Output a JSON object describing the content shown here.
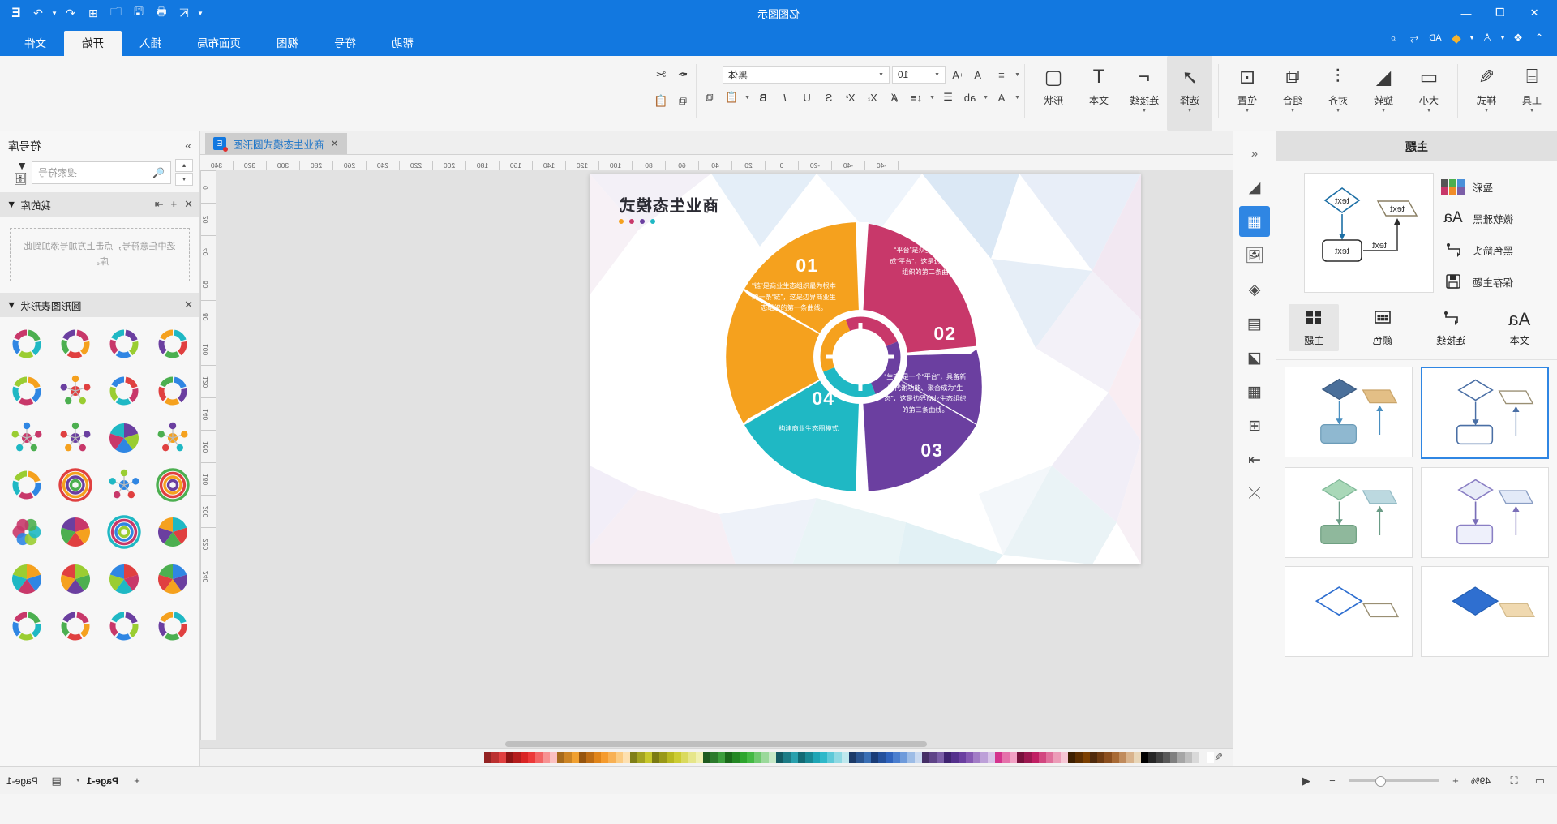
{
  "app": {
    "title": "亿图图示",
    "logo": "E"
  },
  "titlebar": {
    "window_controls": [
      "minimize",
      "maximize",
      "close"
    ],
    "quick_access": [
      {
        "name": "redo-icon",
        "glyph": "↷"
      },
      {
        "name": "undo-icon",
        "glyph": "↶"
      },
      {
        "name": "new-icon",
        "glyph": "⊞"
      },
      {
        "name": "open-icon",
        "glyph": "🗁"
      },
      {
        "name": "save-icon",
        "glyph": "🖫"
      },
      {
        "name": "print-icon",
        "glyph": "🖶"
      },
      {
        "name": "export-icon",
        "glyph": "⇱"
      },
      {
        "name": "customize-qat-icon",
        "glyph": "▼"
      }
    ]
  },
  "tabs": {
    "items": [
      {
        "label": "文件",
        "active": false
      },
      {
        "label": "开始",
        "active": true
      },
      {
        "label": "插入",
        "active": false
      },
      {
        "label": "页面布局",
        "active": false
      },
      {
        "label": "视图",
        "active": false
      },
      {
        "label": "符号",
        "active": false
      },
      {
        "label": "帮助",
        "active": false
      }
    ],
    "left_tools": [
      {
        "name": "pointer-icon",
        "glyph": "⌁"
      },
      {
        "name": "connector-tool-icon",
        "glyph": "⤳"
      },
      {
        "name": "ad-label",
        "glyph": "AD"
      },
      {
        "name": "diamond-icon",
        "glyph": "◆"
      },
      {
        "name": "shirt-icon",
        "glyph": "♕"
      },
      {
        "name": "grid-apps-icon",
        "glyph": "⊞"
      },
      {
        "name": "collapse-ribbon-icon",
        "glyph": "^"
      }
    ]
  },
  "ribbon": {
    "groups": [
      {
        "name": "shape",
        "label": "形状",
        "icon": "▢"
      },
      {
        "name": "text",
        "label": "文本",
        "icon": "T"
      },
      {
        "name": "connector",
        "label": "连接线",
        "icon": "⌐"
      },
      {
        "name": "select",
        "label": "选择",
        "icon": "↗",
        "selected": true
      },
      {
        "name": "position",
        "label": "位置",
        "icon": "⊡"
      },
      {
        "name": "combine",
        "label": "组合",
        "icon": "⧉"
      },
      {
        "name": "align",
        "label": "对齐",
        "icon": "≡"
      },
      {
        "name": "rotate",
        "label": "旋转",
        "icon": "◣"
      },
      {
        "name": "size",
        "label": "大小",
        "icon": "▭"
      },
      {
        "name": "style",
        "label": "样式",
        "icon": "✎"
      },
      {
        "name": "tools",
        "label": "工具",
        "icon": "⌸"
      }
    ],
    "font": {
      "family": "黑体",
      "size": "10",
      "buttons_row1": [
        {
          "name": "increase-font-size-icon",
          "glyph": "A",
          "sup": "+"
        },
        {
          "name": "decrease-font-size-icon",
          "glyph": "A",
          "sup": "−"
        },
        {
          "name": "align-text-icon",
          "glyph": "≡"
        }
      ],
      "buttons_row2": [
        {
          "name": "copy-format-icon",
          "glyph": "⧉"
        },
        {
          "name": "paste-icon",
          "glyph": "📋"
        },
        {
          "name": "bold-icon",
          "glyph": "B"
        },
        {
          "name": "italic-icon",
          "glyph": "I"
        },
        {
          "name": "underline-icon",
          "glyph": "U"
        },
        {
          "name": "strikethrough-icon",
          "glyph": "S"
        },
        {
          "name": "superscript-icon",
          "glyph": "X"
        },
        {
          "name": "subscript-icon",
          "glyph": "X"
        },
        {
          "name": "text-case-icon",
          "glyph": "Aa"
        },
        {
          "name": "line-spacing-icon",
          "glyph": "≡"
        },
        {
          "name": "bullet-list-icon",
          "glyph": "≔"
        }
      ],
      "right_buttons": [
        {
          "name": "cut-icon",
          "glyph": "✂"
        },
        {
          "name": "format-painter-icon",
          "glyph": "✒"
        }
      ]
    }
  },
  "left_panel": {
    "title": "主题",
    "rows": [
      {
        "label": "保存主题",
        "icon": "save-theme-icon",
        "glyph": "🖫"
      },
      {
        "label": "黑色箭头",
        "icon": "connector-style-icon",
        "glyph": "⌐"
      },
      {
        "label": "微软雅黑",
        "icon": "font-theme-icon",
        "glyph": "Aa"
      },
      {
        "label": "盈彩",
        "icon": "color-theme-icon",
        "glyph": "swatches"
      }
    ],
    "swatches": [
      "#4a90d9",
      "#4caf50",
      "#555555",
      "#7b5ea7",
      "#f08c28",
      "#c8386a"
    ],
    "tabs": [
      {
        "label": "主题",
        "icon": "theme-icon",
        "glyph": "▦",
        "active": true
      },
      {
        "label": "颜色",
        "icon": "palette-icon",
        "glyph": "▩",
        "active": false
      },
      {
        "label": "连接线",
        "icon": "connector-icon",
        "glyph": "⌐",
        "active": false
      },
      {
        "label": "文本",
        "icon": "text-icon",
        "glyph": "Aa",
        "active": false
      }
    ],
    "preview_label": "text"
  },
  "rail": {
    "items": [
      {
        "name": "collapse-panel-icon",
        "glyph": "«"
      },
      {
        "name": "fill-icon",
        "glyph": "◣"
      },
      {
        "name": "theme-grid-icon",
        "glyph": "▦",
        "active": true
      },
      {
        "name": "image-icon",
        "glyph": "🖼"
      },
      {
        "name": "layers-icon",
        "glyph": "◈"
      },
      {
        "name": "notes-icon",
        "glyph": "📄"
      },
      {
        "name": "chart-icon",
        "glyph": "◪"
      },
      {
        "name": "table-icon",
        "glyph": "▦"
      },
      {
        "name": "container-icon",
        "glyph": "⊞"
      },
      {
        "name": "align-tool-icon",
        "glyph": "⇤"
      },
      {
        "name": "shuffle-icon",
        "glyph": "⤬"
      }
    ]
  },
  "document": {
    "tab_title": "商业生态模式圆形图",
    "ruler_h": [
      "340",
      "320",
      "300",
      "280",
      "260",
      "240",
      "220",
      "200",
      "180",
      "160",
      "140",
      "120",
      "100",
      "80",
      "60",
      "40",
      "20",
      "0",
      "-20",
      "-40"
    ],
    "ruler_v": [
      "0",
      "20",
      "40",
      "60",
      "80",
      "100",
      "120",
      "140",
      "160",
      "180",
      "200",
      "220",
      "240"
    ]
  },
  "chart_data": {
    "type": "pie",
    "title": "商业生态模式",
    "legend_dots": [
      "#1fb8c4",
      "#6b3fa0",
      "#c8386a",
      "#f5a11e"
    ],
    "center_hub": true,
    "segments": [
      {
        "number": "01",
        "color": "#f5a11e",
        "text": "“链”是商业生态组织最为根本的一条“链”，这是边界商业生态组织的第一条曲线。"
      },
      {
        "number": "02",
        "color": "#c8386a",
        "text": "“平台”是众多的“链”聚合形成“平台”，这是边界商业生态组织的第二条曲线。"
      },
      {
        "number": "03",
        "color": "#6b3fa0",
        "text": "“生态”是一个“平台”，具备新陈代谢功能、聚合成为“生态”，这是边界商业生态组织的第三条曲线。"
      },
      {
        "number": "04",
        "color": "#1fb8c4",
        "text": "构建商业生态圈模式"
      }
    ]
  },
  "right_panel": {
    "title": "符号库",
    "collapse_icon": "»",
    "search_placeholder": "搜索符号",
    "library_icon": "symbol-library-icon",
    "sections": [
      {
        "title": "我的库",
        "actions": [
          "import-icon",
          "add-icon",
          "close-icon"
        ],
        "empty_text": "选中任意符号，点击上方加号添加到此库。"
      },
      {
        "title": "圆形图表形状",
        "actions": [
          "close-icon"
        ]
      }
    ]
  },
  "status_bar": {
    "zoom_out_icon": "−",
    "zoom_in_icon": "+",
    "zoom_percent": "49%",
    "fullscreen_icon": "⛶",
    "fit_icon": "⤢",
    "play_icon": "◀",
    "page_current": "Page-1",
    "page_name": "Page-1",
    "add_page_icon": "+",
    "page_list_icon": "▭"
  },
  "palette": {
    "colors": [
      "#ffffff",
      "#f2f2f2",
      "#d9d9d9",
      "#bfbfbf",
      "#a6a6a6",
      "#808080",
      "#595959",
      "#404040",
      "#262626",
      "#000000",
      "#e8d5b7",
      "#d9b38c",
      "#c08b5c",
      "#a86a35",
      "#8b4f1f",
      "#6d3b12",
      "#4f2a0c",
      "#7b3f00",
      "#5c2e00",
      "#3d1f00",
      "#f6c6d4",
      "#ec9cb8",
      "#e0709c",
      "#d24780",
      "#c01f63",
      "#9c1850",
      "#77113c",
      "#f2a0c4",
      "#e571ab",
      "#d4338d",
      "#d8c4e8",
      "#bda0d8",
      "#a27cc6",
      "#8659b3",
      "#6b3fa0",
      "#54308c",
      "#3f2370",
      "#7b5ea7",
      "#5f4488",
      "#452f66",
      "#c9d9f0",
      "#9dbce6",
      "#6f9bdb",
      "#4a7ecf",
      "#2f63bd",
      "#24509c",
      "#1a3c77",
      "#3a6fb5",
      "#2a5490",
      "#1c3a68",
      "#bfe8ee",
      "#8fd9e3",
      "#5ec9d8",
      "#2fb8c9",
      "#1fa5b5",
      "#188894",
      "#126a74",
      "#29a0ad",
      "#1d7c86",
      "#135a62",
      "#c6e8c6",
      "#9bd99b",
      "#6fc96f",
      "#44b944",
      "#2ea52e",
      "#248724",
      "#1a691a",
      "#3c9e3c",
      "#2c7a2c",
      "#1e5a1e",
      "#f0f0b0",
      "#e6e68a",
      "#dada5e",
      "#cccc33",
      "#b8b820",
      "#999918",
      "#7a7a12",
      "#c7c72b",
      "#a3a320",
      "#7f7f18",
      "#fde0b0",
      "#fbcb82",
      "#f8b154",
      "#f59b2e",
      "#e08419",
      "#bd6c13",
      "#96550e",
      "#f0a030",
      "#cc8424",
      "#a66a1b",
      "#fbc0c0",
      "#f79292",
      "#f26464",
      "#ec3838",
      "#d92424",
      "#b41c1c",
      "#8d1414",
      "#e04040",
      "#bb3030",
      "#932323"
    ]
  }
}
